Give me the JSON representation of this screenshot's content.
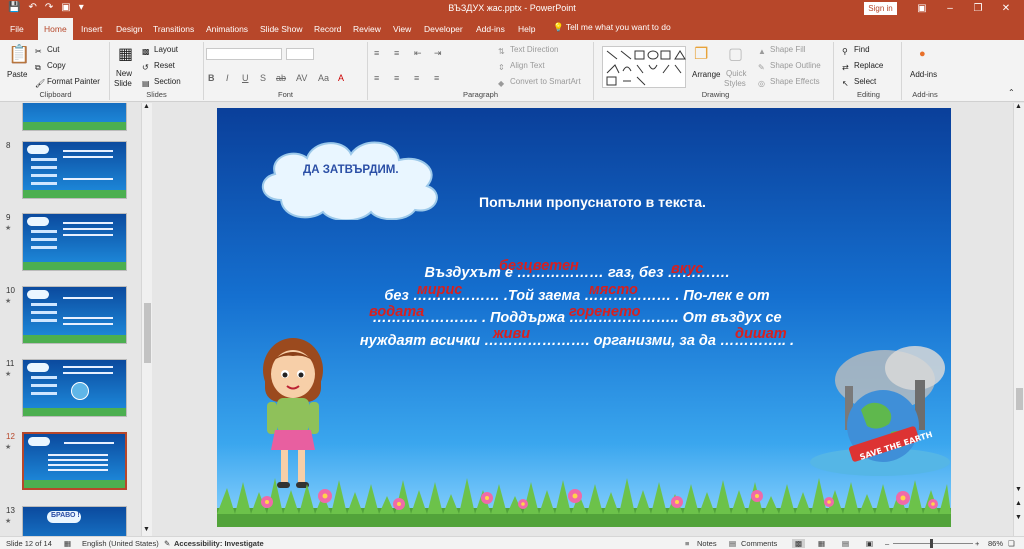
{
  "window": {
    "title": "ВЪЗДУХ жас.pptx  -  PowerPoint",
    "sign_in": "Sign in"
  },
  "tabs": [
    {
      "label": "File"
    },
    {
      "label": "Home"
    },
    {
      "label": "Insert"
    },
    {
      "label": "Design"
    },
    {
      "label": "Transitions"
    },
    {
      "label": "Animations"
    },
    {
      "label": "Slide Show"
    },
    {
      "label": "Record"
    },
    {
      "label": "Review"
    },
    {
      "label": "View"
    },
    {
      "label": "Developer"
    },
    {
      "label": "Add-ins"
    },
    {
      "label": "Help"
    }
  ],
  "tell_me": "Tell me what you want to do",
  "ribbon": {
    "clipboard": {
      "paste": "Paste",
      "cut": "Cut",
      "copy": "Copy",
      "format_painter": "Format Painter",
      "label": "Clipboard"
    },
    "slides": {
      "new_slide": "New",
      "new_slide2": "Slide",
      "layout": "Layout",
      "reset": "Reset",
      "section": "Section",
      "label": "Slides"
    },
    "font": {
      "label": "Font"
    },
    "paragraph": {
      "text_direction": "Text Direction",
      "align_text": "Align Text",
      "convert": "Convert to SmartArt",
      "label": "Paragraph"
    },
    "drawing": {
      "arrange": "Arrange",
      "quick_styles": "Quick",
      "quick_styles2": "Styles",
      "shape_fill": "Shape Fill",
      "shape_outline": "Shape Outline",
      "shape_effects": "Shape Effects",
      "label": "Drawing"
    },
    "editing": {
      "find": "Find",
      "replace": "Replace",
      "select": "Select",
      "label": "Editing"
    },
    "addins": {
      "addins": "Add-ins",
      "label": "Add-ins"
    }
  },
  "thumbnails": [
    {
      "num": "8"
    },
    {
      "num": "9"
    },
    {
      "num": "10"
    },
    {
      "num": "11"
    },
    {
      "num": "12"
    },
    {
      "num": "13"
    }
  ],
  "thumb13_title": "БРАВО !",
  "slide": {
    "cloud_title": "ДА ЗАТВЪРДИМ.",
    "instruction": "Попълни пропуснатото в текста.",
    "lines": [
      "Въздухът е ……………… газ, без ………….",
      "без ……………… .Той заема ……………… . По-лек е от",
      "…………………. . Поддържа ………………….. От въздух се",
      "нуждаят всички …………………. организми, за да ………….. ."
    ],
    "answers": {
      "a1": "безцветен",
      "a2": "вкус",
      "a3": "мирис",
      "a4": "място",
      "a5": "водата",
      "a6": "горенето",
      "a7": "живи",
      "a8": "дишат"
    },
    "earth_banner": "SAVE THE EARTH"
  },
  "status": {
    "slide": "Slide 12 of 14",
    "language": "English (United States)",
    "accessibility": "Accessibility: Investigate",
    "notes": "Notes",
    "comments": "Comments",
    "zoom": "86%"
  }
}
